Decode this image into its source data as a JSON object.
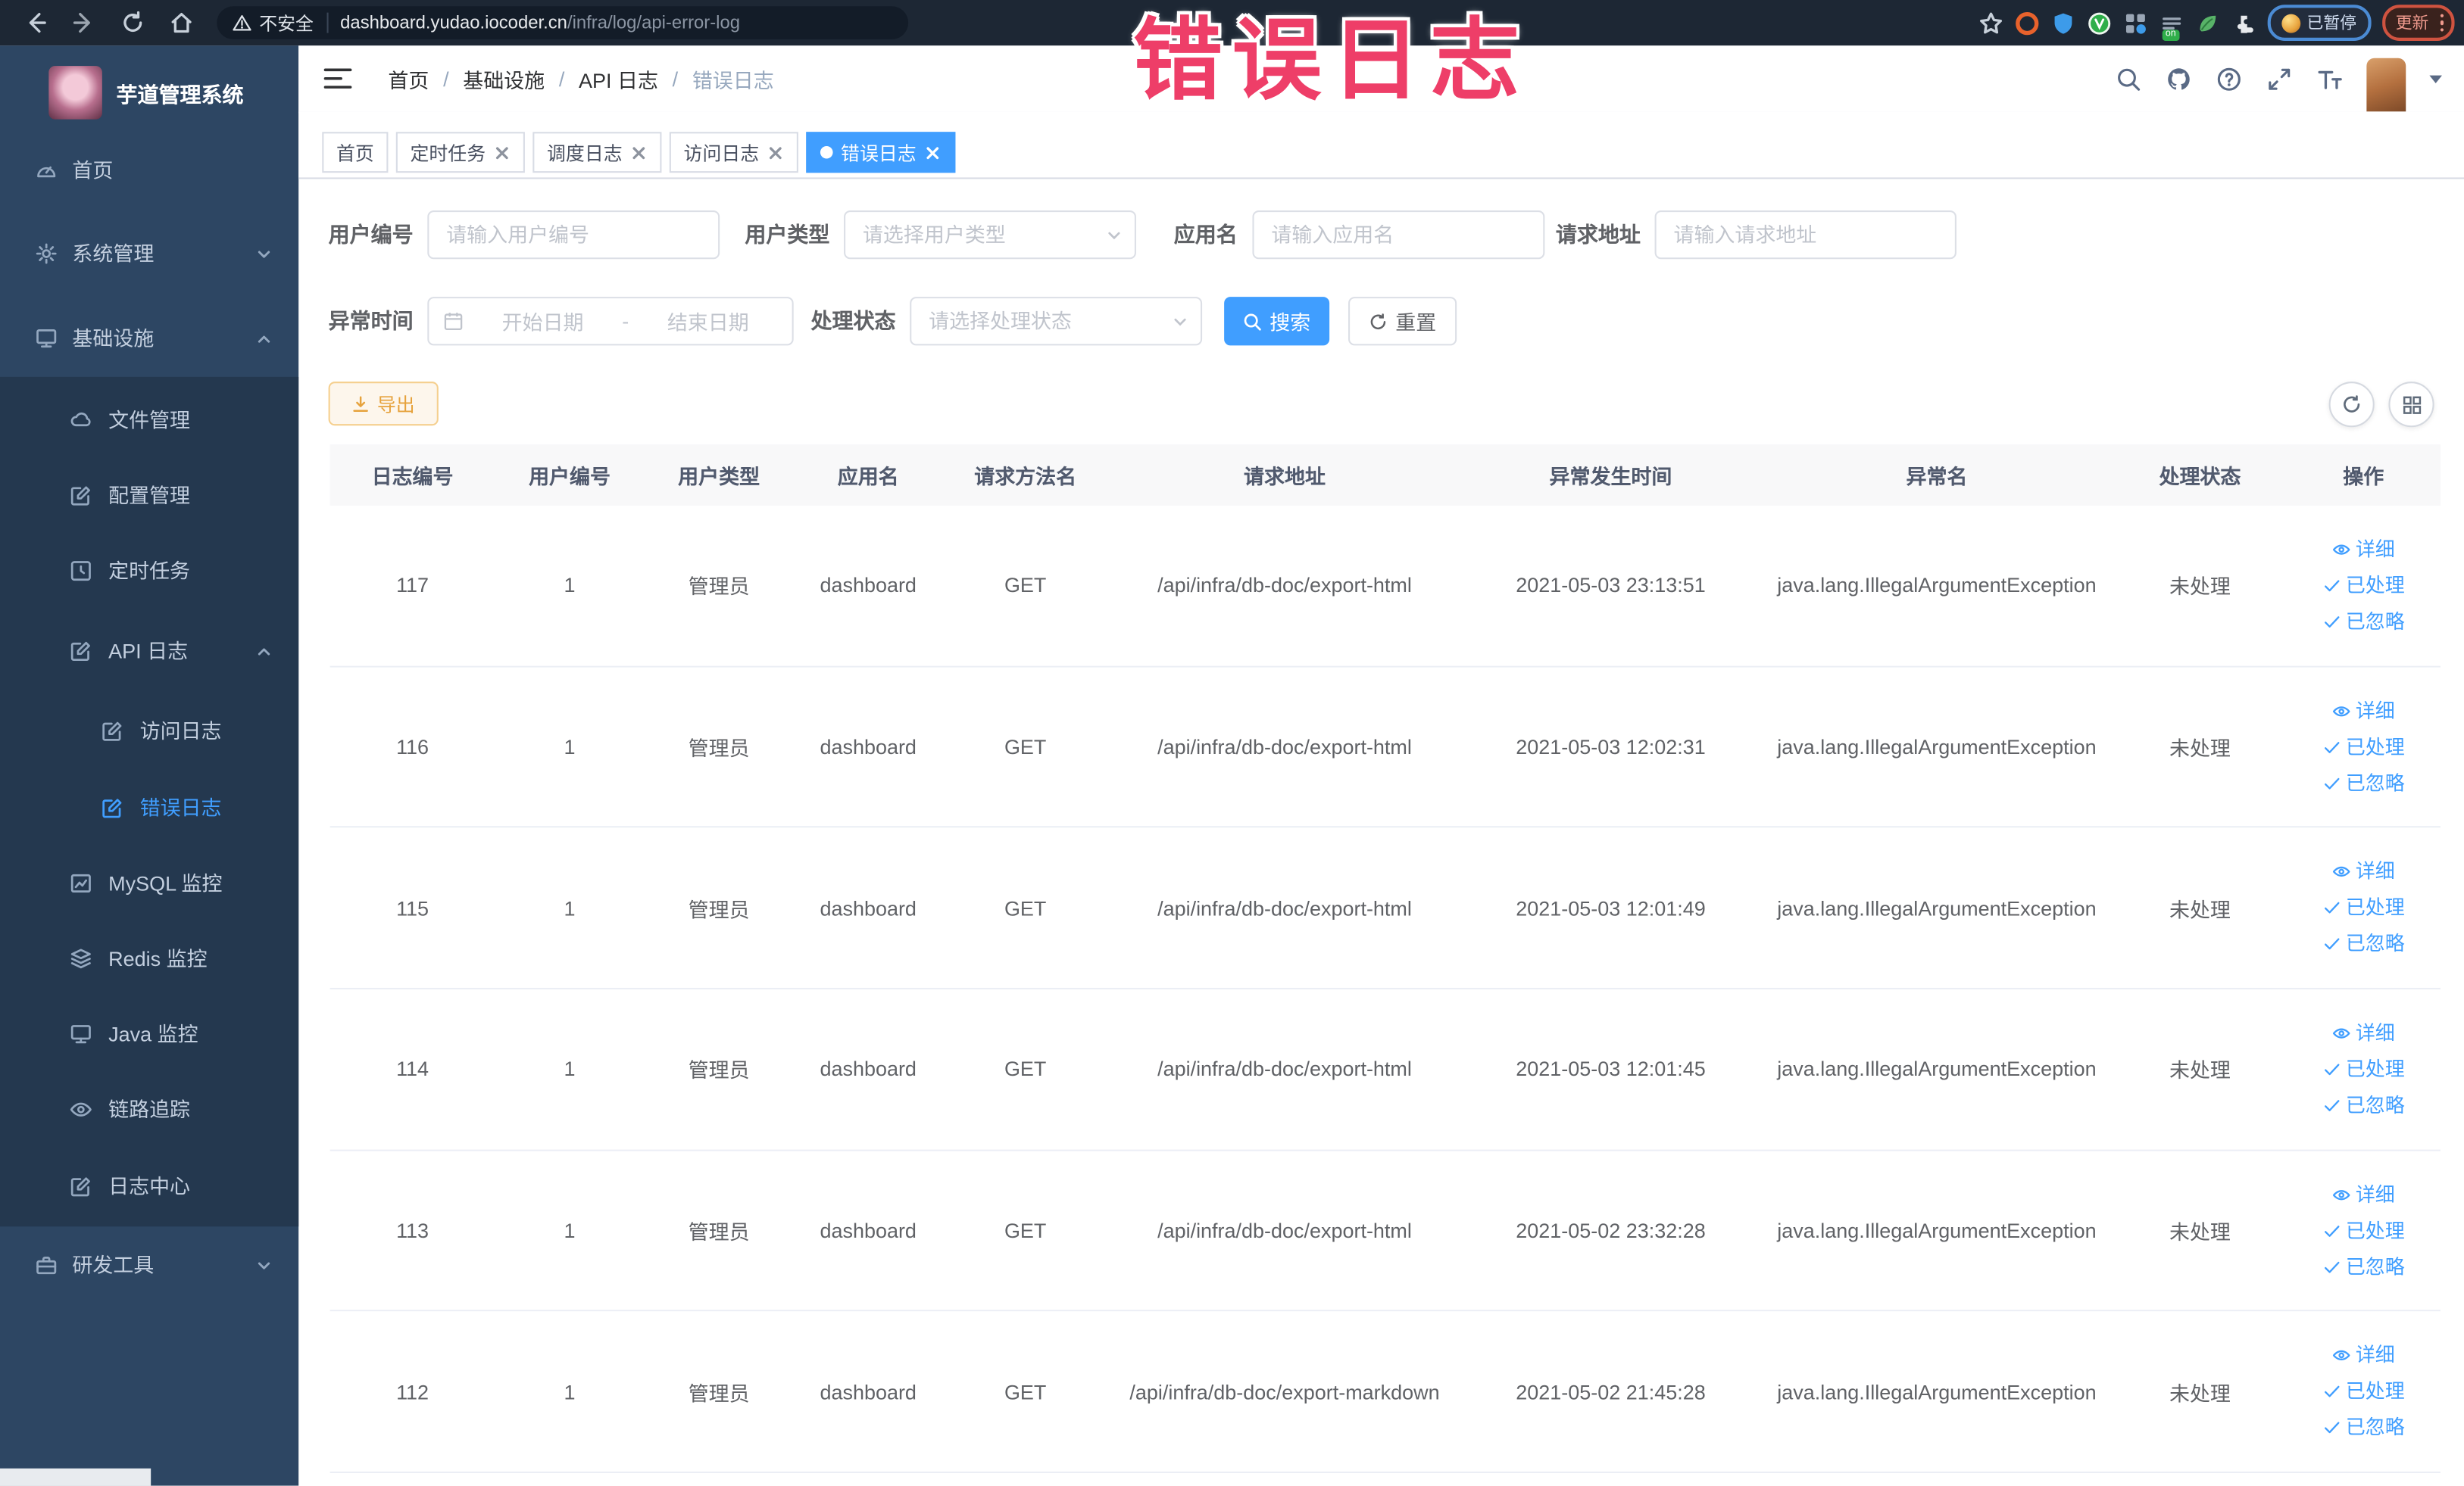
{
  "browser": {
    "security_label": "不安全",
    "url_host": "dashboard.yudao.iocoder.cn",
    "url_path": "/infra/log/api-error-log",
    "paused_chip": "已暂停",
    "update_chip": "更新",
    "extension_badge": "on"
  },
  "overlay": {
    "title": "错误日志"
  },
  "sidebar": {
    "app_title": "芋道管理系统",
    "items": [
      {
        "label": "首页"
      },
      {
        "label": "系统管理"
      },
      {
        "label": "基础设施"
      },
      {
        "label": "文件管理"
      },
      {
        "label": "配置管理"
      },
      {
        "label": "定时任务"
      },
      {
        "label": "API 日志"
      },
      {
        "label": "访问日志"
      },
      {
        "label": "错误日志"
      },
      {
        "label": "MySQL 监控"
      },
      {
        "label": "Redis 监控"
      },
      {
        "label": "Java 监控"
      },
      {
        "label": "链路追踪"
      },
      {
        "label": "日志中心"
      },
      {
        "label": "研发工具"
      }
    ]
  },
  "header": {
    "breadcrumb": [
      "首页",
      "基础设施",
      "API 日志",
      "错误日志"
    ],
    "breadcrumb_separator": "/"
  },
  "tabs": [
    {
      "label": "首页"
    },
    {
      "label": "定时任务"
    },
    {
      "label": "调度日志"
    },
    {
      "label": "访问日志"
    },
    {
      "label": "错误日志"
    }
  ],
  "filters": {
    "user_id_label": "用户编号",
    "user_id_placeholder": "请输入用户编号",
    "user_type_label": "用户类型",
    "user_type_placeholder": "请选择用户类型",
    "app_name_label": "应用名",
    "app_name_placeholder": "请输入应用名",
    "request_url_label": "请求地址",
    "request_url_placeholder": "请输入请求地址",
    "exception_time_label": "异常时间",
    "start_placeholder": "开始日期",
    "range_separator": "-",
    "end_placeholder": "结束日期",
    "status_label": "处理状态",
    "status_placeholder": "请选择处理状态",
    "search_button": "搜索",
    "reset_button": "重置"
  },
  "toolbar": {
    "export_button": "导出"
  },
  "table": {
    "columns": [
      "日志编号",
      "用户编号",
      "用户类型",
      "应用名",
      "请求方法名",
      "请求地址",
      "异常发生时间",
      "异常名",
      "处理状态",
      "操作"
    ],
    "actions": [
      "详细",
      "已处理",
      "已忽略"
    ],
    "rows": [
      {
        "id": "117",
        "user_id": "1",
        "user_type": "管理员",
        "app": "dashboard",
        "method": "GET",
        "url": "/api/infra/db-doc/export-html",
        "time": "2021-05-03 23:13:51",
        "exception": "java.lang.IllegalArgumentException",
        "status": "未处理"
      },
      {
        "id": "116",
        "user_id": "1",
        "user_type": "管理员",
        "app": "dashboard",
        "method": "GET",
        "url": "/api/infra/db-doc/export-html",
        "time": "2021-05-03 12:02:31",
        "exception": "java.lang.IllegalArgumentException",
        "status": "未处理"
      },
      {
        "id": "115",
        "user_id": "1",
        "user_type": "管理员",
        "app": "dashboard",
        "method": "GET",
        "url": "/api/infra/db-doc/export-html",
        "time": "2021-05-03 12:01:49",
        "exception": "java.lang.IllegalArgumentException",
        "status": "未处理"
      },
      {
        "id": "114",
        "user_id": "1",
        "user_type": "管理员",
        "app": "dashboard",
        "method": "GET",
        "url": "/api/infra/db-doc/export-html",
        "time": "2021-05-03 12:01:45",
        "exception": "java.lang.IllegalArgumentException",
        "status": "未处理"
      },
      {
        "id": "113",
        "user_id": "1",
        "user_type": "管理员",
        "app": "dashboard",
        "method": "GET",
        "url": "/api/infra/db-doc/export-html",
        "time": "2021-05-02 23:32:28",
        "exception": "java.lang.IllegalArgumentException",
        "status": "未处理"
      },
      {
        "id": "112",
        "user_id": "1",
        "user_type": "管理员",
        "app": "dashboard",
        "method": "GET",
        "url": "/api/infra/db-doc/export-markdown",
        "time": "2021-05-02 21:45:28",
        "exception": "java.lang.IllegalArgumentException",
        "status": "未处理"
      }
    ]
  },
  "colors": {
    "accent": "#409eff",
    "sidebar_bg": "#2d4663",
    "submenu_bg": "#24384f",
    "warning": "#e6a23c",
    "overlay_pink": "#ee3e68",
    "chrome_bg": "#1d2734"
  }
}
